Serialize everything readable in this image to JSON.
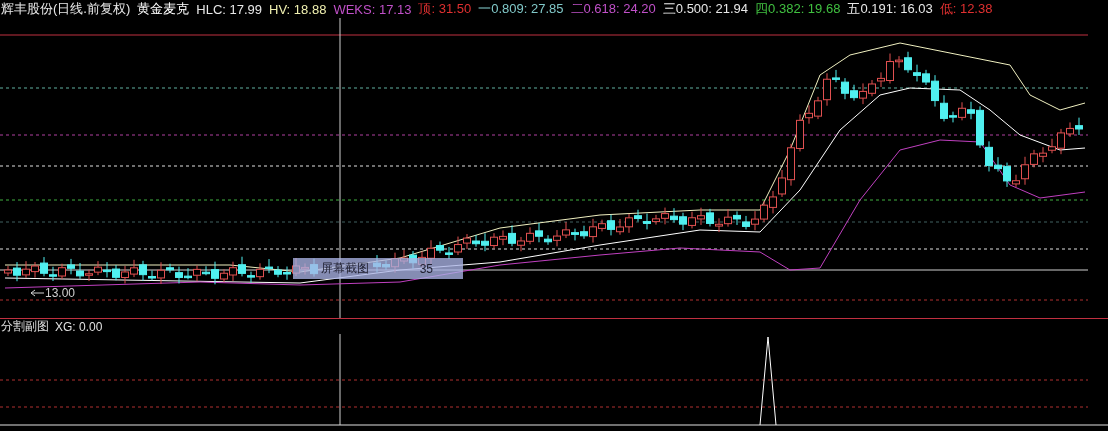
{
  "header": {
    "items": [
      {
        "label": "辉丰股份(日线.前复权)",
        "color": "#e8e8e8"
      },
      {
        "label": "黄金麦克",
        "color": "#ffffff"
      },
      {
        "label": "HLC: 17.99",
        "color": "#e8e8e8"
      },
      {
        "label": "HV: 18.88",
        "color": "#f0f0b0"
      },
      {
        "label": "WEKS: 17.13",
        "color": "#c050c8"
      },
      {
        "label": "顶: 31.50",
        "color": "#e03030"
      },
      {
        "label": "一0.809: 27.85",
        "color": "#80c8c8"
      },
      {
        "label": "二0.618: 24.20",
        "color": "#c050c8"
      },
      {
        "label": "三0.500: 21.94",
        "color": "#e8e8e8"
      },
      {
        "label": "四0.382: 19.68",
        "color": "#40c040"
      },
      {
        "label": "五0.191: 16.03",
        "color": "#e8e8e8"
      },
      {
        "label": "低: 12.38",
        "color": "#e03030"
      }
    ]
  },
  "main_chart": {
    "low_marker": "13.00",
    "overlay": {
      "title": "屏幕截图",
      "value": "35"
    }
  },
  "subchart": {
    "title": "分割副图",
    "reading": "XG: 0.00"
  }
}
